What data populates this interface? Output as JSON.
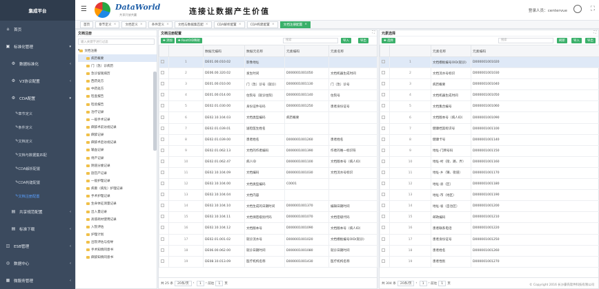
{
  "brand": "集成平台",
  "menu": [
    {
      "label": "首页",
      "icon": "home-icon",
      "arrow": ""
    },
    {
      "label": "标准化管理",
      "icon": "standard-icon",
      "arrow": "▾"
    },
    {
      "label": "数据标准化",
      "icon": "gear-icon",
      "arrow": "‹",
      "sub": true
    },
    {
      "label": "V3协议配置",
      "icon": "gear-icon",
      "arrow": "‹",
      "sub": true
    },
    {
      "label": "CDA配置",
      "icon": "gear-icon",
      "arrow": "▾",
      "sub": true
    },
    {
      "label": "章节定义",
      "icon": "wrench-icon",
      "arrow": "",
      "sub2": true
    },
    {
      "label": "条件定义",
      "icon": "wrench-icon",
      "arrow": "",
      "sub2": true
    },
    {
      "label": "文档定义",
      "icon": "wrench-icon",
      "arrow": "",
      "sub2": true
    },
    {
      "label": "文档与数据集匹配",
      "icon": "wrench-icon",
      "arrow": "",
      "sub2": true
    },
    {
      "label": "CDA解析配置",
      "icon": "wrench-icon",
      "arrow": "",
      "sub2": true
    },
    {
      "label": "CDA构建配置",
      "icon": "wrench-icon",
      "arrow": "",
      "sub2": true
    },
    {
      "label": "文档注册配置",
      "icon": "wrench-icon",
      "arrow": "",
      "sub2": true,
      "active": true
    },
    {
      "label": "共享规范配置",
      "icon": "folder-icon",
      "arrow": "‹",
      "sub": true
    },
    {
      "label": "标准下载",
      "icon": "folder-icon",
      "arrow": "‹",
      "sub": true
    },
    {
      "label": "ESB管理",
      "icon": "server-icon",
      "arrow": "‹"
    },
    {
      "label": "数据中心",
      "icon": "database-icon",
      "arrow": "‹"
    },
    {
      "label": "微服务管理",
      "icon": "grid-icon",
      "arrow": "‹"
    }
  ],
  "header": {
    "logo_title": "DataWorld",
    "logo_sub": "共享开放共赢",
    "slogan": "连接让数据产生价值",
    "user": "登录人员：centervue"
  },
  "tabs": [
    {
      "label": "首页"
    },
    {
      "label": "章节定义"
    },
    {
      "label": "文档定义"
    },
    {
      "label": "条件定义"
    },
    {
      "label": "文档与数据集匹配"
    },
    {
      "label": "CDA解析配置"
    },
    {
      "label": "CDA构建配置"
    },
    {
      "label": "文档注册配置",
      "active": true
    }
  ],
  "tree": {
    "title": "文档注册",
    "search": "输入关键字进行过滤",
    "root": "文档注册",
    "nodes": [
      "病历概要",
      "门（急）诊病历",
      "急诊留观病历",
      "西药处方",
      "中药处方",
      "检查报告",
      "检验报告",
      "治疗记录",
      "一般手术记录",
      "麻醉术前访视记录",
      "麻醉记录",
      "麻醉术后访视记录",
      "输血记录",
      "待产记录",
      "阴道分娩记录",
      "剖宫产记录",
      "一般护理记录",
      "病重（病危）护理记录",
      "手术护理记录",
      "生命体征测量记录",
      "出入量记录",
      "高值耗材使用记录",
      "入院评估",
      "护理计划",
      "出院评估与指导",
      "手术知情同意书",
      "麻醉知情同意书"
    ]
  },
  "grid1": {
    "title": "文档注册配置",
    "add": "添加",
    "root_btn": "RootOID映射",
    "search": "搜索",
    "cols": [
      "数据元编码",
      "数据元名称",
      "元素编码",
      "元素名称",
      "元素路径"
    ],
    "rows": [
      [
        "DE01.00.010.02",
        "影像地址",
        "",
        "",
        ""
      ],
      [
        "DE06.00.320.02",
        "发生时间",
        "D000001001050",
        "文档机器生成时间",
        "/effectiveTime"
      ],
      [
        "DE01.00.010.00",
        "门（急）诊号（就诊）",
        "D000001001130",
        "门（急）诊号",
        "/component/structur"
      ],
      [
        "DE01.00.014.00",
        "住院号（就诊住院）",
        "D000001001140",
        "住院号",
        "/component/structur"
      ],
      [
        "DE02.01.030.00",
        "身份证件号码",
        "D000001001250",
        "患者身份证号",
        "/recordTarget/patient"
      ],
      [
        "DE02.10.104.03",
        "文档类型编码",
        "病历概要",
        "",
        " "
      ],
      [
        "DE02.01.039.01",
        "送检医生姓名",
        "",
        "",
        ""
      ],
      [
        "DE02.01.039.00",
        "患者姓名",
        "D000001001260",
        "患者姓名",
        "/recordTarget/patient"
      ],
      [
        "DE02.01.062.13",
        "文档的作者编码",
        "D000001001390",
        "作者的唯一标识符",
        "/author/assigned/Aut"
      ],
      [
        "DE02.01.062.47",
        "病人ID",
        "D000001001100",
        "文档版本号（病人ID）",
        "/versionNumber"
      ],
      [
        "DE02.10.104.09",
        "文档编码",
        "D000001001030",
        "文档流水号标识",
        "/id"
      ],
      [
        "DE02.10.104.00",
        "文档类型编码",
        "C0001",
        "",
        ""
      ],
      [
        "DE02.10.104.04",
        "文档内容",
        "",
        "",
        ""
      ],
      [
        "DE02.10.104.10",
        "文档生成的日期时间",
        "D000001001370",
        "编辑日期时间",
        "/authorTime"
      ],
      [
        "DE02.10.104.11",
        "文档保密级别代码",
        "D000001001070",
        "文档密级代码",
        "/confidentialityCode"
      ],
      [
        "DE02.10.104.12",
        "文档版本号",
        "D000001001090",
        "文档版本号（病人ID）",
        "/versionNumber"
      ],
      [
        "DE02.01.001.02",
        "就诊流水号",
        "D000001001020",
        "文档模板编号OID(就诊)",
        "/templateId"
      ],
      [
        "DE06.00.062.00",
        "就诊日期时间",
        "D000001001080",
        "就诊日期时间",
        "/component/structur"
      ],
      [
        "DE08.10.013.09",
        "医疗机构名称",
        "D000001001430",
        "医疗机构名称",
        "/author/assigned/Aut"
      ]
    ],
    "total": "共 25 条",
    "pagesize": "20条/页",
    "goto": "前往",
    "page": "1",
    "pageunit": "页"
  },
  "grid2": {
    "title": "元素选择",
    "select": "选择",
    "refresh": "刷新",
    "import": "导入",
    "export": "导出",
    "search": "搜索",
    "cols": [
      "元素名称",
      "元素编码",
      "元素路径"
    ],
    "rows": [
      [
        "文档模板编号OID(就诊)",
        "D000001001020",
        "/templateId"
      ],
      [
        "文档流水号标识",
        "D000001001030",
        "/id"
      ],
      [
        "病历概要",
        "D000001001040",
        "/title"
      ],
      [
        "文档机器生成时间",
        "D000001001050",
        "/effectiveTime"
      ],
      [
        "文档集合编号",
        "D000001001060",
        "/setId"
      ],
      [
        "文档版本号（病人ID）",
        "D000001001090",
        "/versionNumber"
      ],
      [
        "健康档案标识号",
        "D000001001100",
        "/recordTarget/patientRole/id"
      ],
      [
        "健康卡号",
        "D000001001140",
        "/recordTarget/patientRole/id"
      ],
      [
        "地址-门牌号码",
        "D000001001150",
        "/recordTarget/patientRole/addr/houseNumber"
      ],
      [
        "地址-村（街、路、弄）",
        "D000001001160",
        "/recordTarget/patientRole/addr/streetName"
      ],
      [
        "地址-乡（镇、街道）",
        "D000001001170",
        "/recordTarget/patientRole/addr/township"
      ],
      [
        "地址-县（区）",
        "D000001001180",
        "/recordTarget/patientRole/addr/county"
      ],
      [
        "地址-市（地区）",
        "D000001001190",
        "/recordTarget/patientRole/addr/city"
      ],
      [
        "地址-省（自治区）",
        "D000001001200",
        "/recordTarget/patientRole/addr/state"
      ],
      [
        "邮政编码",
        "D000001001210",
        "/recordTarget/patientRole/addr/postalCode"
      ],
      [
        "患者联系电话",
        "D000001001220",
        "/recordTarget/patientRole/telecom"
      ],
      [
        "患者身份证号",
        "D000001001250",
        "/recordTarget/patientRole/patient/id"
      ],
      [
        "患者姓名",
        "D000001001260",
        "/recordTarget/patientRole/patient/name"
      ],
      [
        "患者性别",
        "D000001001270",
        "/recordTarget/patientRole/patient/administrativeGenderCode"
      ]
    ],
    "total": "共 304 条",
    "pagesize": "20条/页",
    "goto": "前往",
    "page": "1",
    "pageunit": "页"
  },
  "copyright": "© Copyright 2016 长沙豪氏软件科技有限公司"
}
